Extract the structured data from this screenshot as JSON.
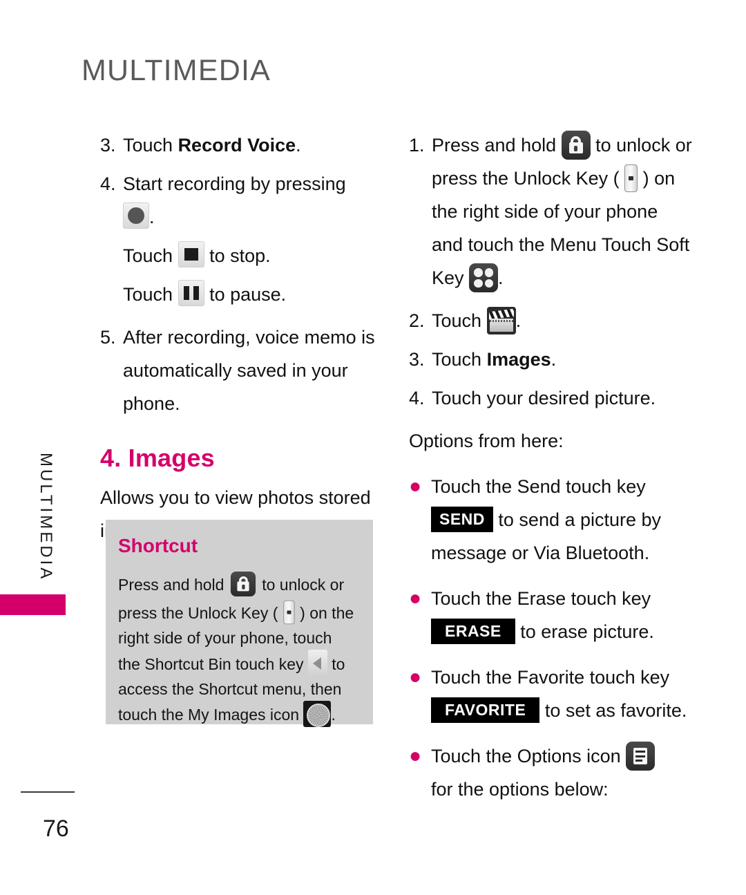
{
  "header": {
    "title": "MULTIMEDIA"
  },
  "side_tab": {
    "label": "MULTIMEDIA",
    "accent_color": "#d4006a"
  },
  "colors": {
    "accent_magenta": "#d4006a",
    "shortcut_bg": "#d0d0d0",
    "key_chip_bg": "#000000",
    "header_gray": "#5a5a5a"
  },
  "left_column": {
    "step3": {
      "num": "3.",
      "text_before": "Touch ",
      "bold": "Record Voice",
      "text_after": "."
    },
    "step4": {
      "num": "4.",
      "text": "Start recording by pressing",
      "record_suffix": ".",
      "stop_before": "Touch ",
      "stop_after": " to stop.",
      "pause_before": "Touch ",
      "pause_after": " to pause."
    },
    "step5": {
      "num": "5.",
      "text": "After recording, voice memo is automatically saved in your phone."
    },
    "section_heading": "4. Images",
    "section_desc": "Allows you to view photos stored in the phone.",
    "shortcut": {
      "title": "Shortcut",
      "part1": "Press and hold ",
      "part2": " to unlock or press the Unlock Key ( ",
      "part3": " ) on the right side of your phone, touch the Shortcut Bin touch key ",
      "part4": " to access the Shortcut menu, then touch the My Images icon ",
      "part5": "."
    }
  },
  "right_column": {
    "step1": {
      "num": "1.",
      "part1": "Press and hold ",
      "part2": " to unlock or press the Unlock Key ( ",
      "part3": " ) on the right side of your phone and touch the Menu Touch Soft Key ",
      "part4": "."
    },
    "step2": {
      "num": "2.",
      "text_before": "Touch ",
      "text_after": "."
    },
    "step3": {
      "num": "3.",
      "text_before": "Touch ",
      "bold": "Images",
      "text_after": "."
    },
    "step4": {
      "num": "4.",
      "text": "Touch your desired picture."
    },
    "options_intro": "Options from here:",
    "bullets": [
      {
        "before": "Touch the Send touch key",
        "chip": "SEND",
        "after": " to send a picture by message or Via Bluetooth."
      },
      {
        "before": "Touch the Erase touch key",
        "chip": "ERASE",
        "after": " to erase picture."
      },
      {
        "before": "Touch the Favorite touch key",
        "chip": "FAVORITE",
        "after": " to set as favorite."
      },
      {
        "before": "Touch the Options icon ",
        "chip": "",
        "after": "for the options below:"
      }
    ]
  },
  "footer": {
    "page_number": "76"
  }
}
